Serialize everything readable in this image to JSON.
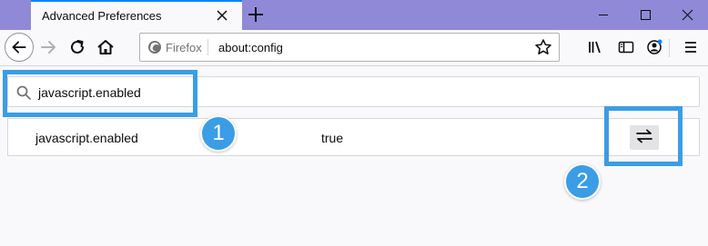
{
  "tab": {
    "title": "Advanced Preferences"
  },
  "urlbar": {
    "identity": "Firefox",
    "url": "about:config"
  },
  "search": {
    "value": "javascript.enabled"
  },
  "preference": {
    "name": "javascript.enabled",
    "value": "true"
  },
  "annotations": {
    "step1": "1",
    "step2": "2"
  },
  "colors": {
    "tabstrip": "#9089d7",
    "highlight": "#3a9de6",
    "accent": "#0a84ff"
  }
}
